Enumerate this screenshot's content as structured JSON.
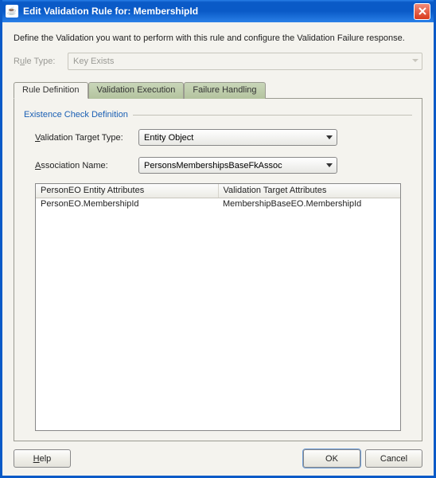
{
  "title": "Edit Validation Rule for: MembershipId",
  "intro": "Define the Validation you want to perform with this rule and configure the Validation Failure response.",
  "ruleType": {
    "label_pre": "R",
    "label_u": "u",
    "label_post": "le Type:",
    "value": "Key Exists"
  },
  "tabs": {
    "definition": "Rule Definition",
    "execution": "Validation Execution",
    "failure": "Failure Handling"
  },
  "group": "Existence Check Definition",
  "targetType": {
    "label_u": "V",
    "label_post": "alidation Target Type:",
    "value": "Entity Object"
  },
  "assocName": {
    "label_u": "A",
    "label_post": "ssociation Name:",
    "value": "PersonsMembershipsBaseFkAssoc"
  },
  "table": {
    "col1": "PersonEO Entity Attributes",
    "col2": "Validation Target Attributes",
    "rows": [
      {
        "a": "PersonEO.MembershipId",
        "b": "MembershipBaseEO.MembershipId"
      }
    ]
  },
  "buttons": {
    "help_u": "H",
    "help_post": "elp",
    "ok": "OK",
    "cancel": "Cancel"
  }
}
